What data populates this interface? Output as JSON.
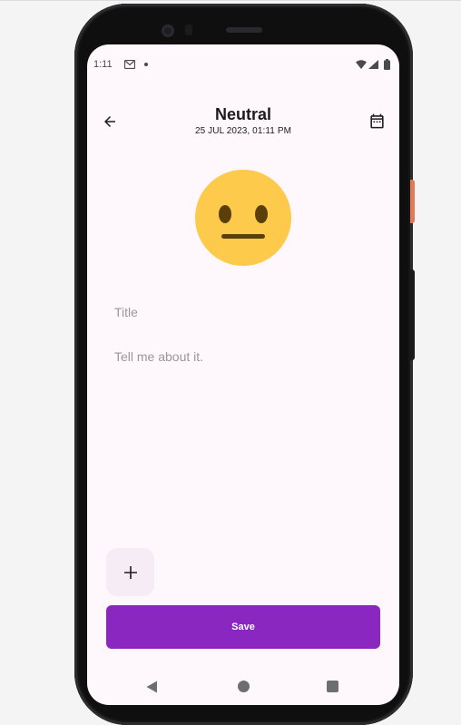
{
  "status_bar": {
    "time": "1:11",
    "icons": [
      "gmail-icon",
      "notification-dot-icon",
      "wifi-icon",
      "signal-icon",
      "battery-icon"
    ]
  },
  "header": {
    "title": "Neutral",
    "subtitle": "25 JUL 2023, 01:11 PM",
    "back_icon": "arrow-back-icon",
    "calendar_icon": "calendar-icon"
  },
  "mood": {
    "emoji_icon": "neutral-face-icon",
    "color": "#fdca4b"
  },
  "form": {
    "title_placeholder": "Title",
    "title_value": "",
    "body_placeholder": "Tell me about it.",
    "body_value": ""
  },
  "actions": {
    "add_icon": "plus-icon",
    "save_label": "Save",
    "save_color": "#8a27c0"
  },
  "nav_bar": {
    "icons": [
      "nav-back-icon",
      "nav-home-icon",
      "nav-recents-icon"
    ]
  }
}
